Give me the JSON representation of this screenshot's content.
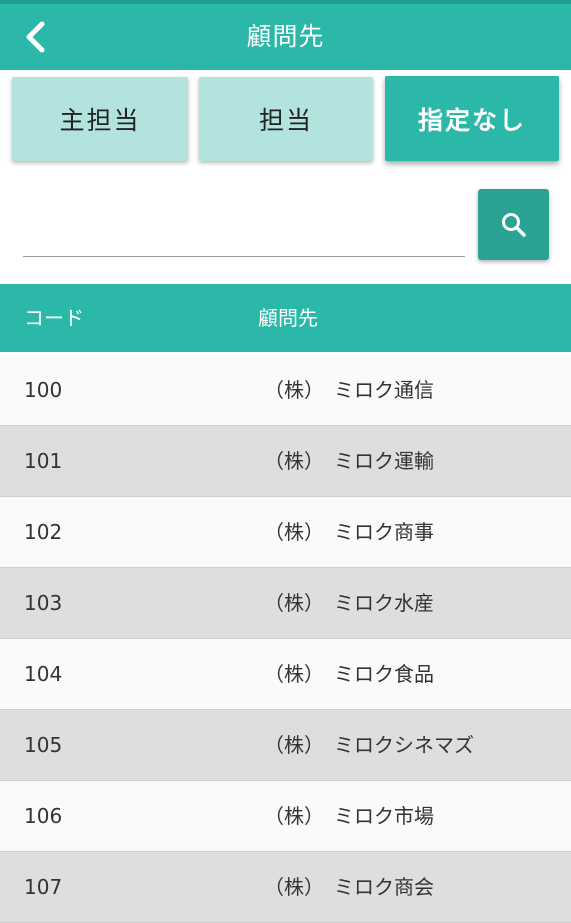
{
  "appbar": {
    "title": "顧問先",
    "back_icon": "chevron-left-icon",
    "background": "#2bb8a8"
  },
  "filters": [
    {
      "label": "主担当",
      "active": false
    },
    {
      "label": "担当",
      "active": false
    },
    {
      "label": "指定なし",
      "active": true
    }
  ],
  "search": {
    "value": "",
    "placeholder": "",
    "button_icon": "search-icon",
    "button_color": "#2aa394"
  },
  "table": {
    "columns": [
      "コード",
      "顧問先"
    ],
    "rows": [
      {
        "code": "100",
        "name": "（株）　ミロク通信"
      },
      {
        "code": "101",
        "name": "（株）　ミロク運輸"
      },
      {
        "code": "102",
        "name": "（株）　ミロク商事"
      },
      {
        "code": "103",
        "name": "（株）　ミロク水産"
      },
      {
        "code": "104",
        "name": "（株）　ミロク食品"
      },
      {
        "code": "105",
        "name": "（株）　ミロクシネマズ"
      },
      {
        "code": "106",
        "name": "（株）　ミロク市場"
      },
      {
        "code": "107",
        "name": "（株）　ミロク商会"
      }
    ]
  },
  "colors": {
    "accent": "#2bb8a8",
    "filter_inactive": "#b3e3de",
    "row_alt": "#dedede"
  }
}
